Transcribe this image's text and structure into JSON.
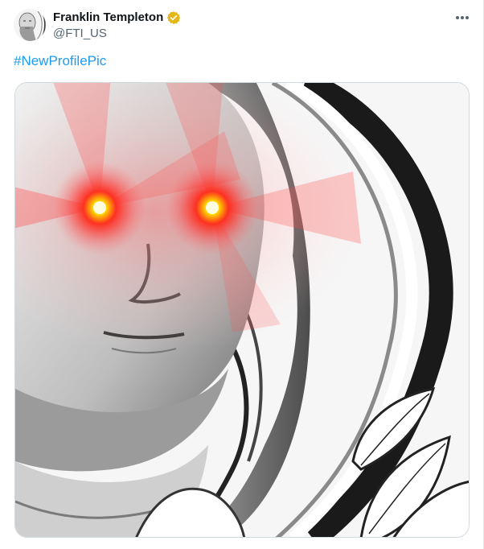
{
  "author": {
    "display_name": "Franklin Templeton",
    "handle": "@FTI_US",
    "verified_badge": "gold-verified-badge-icon",
    "badge_color": "#e2b719"
  },
  "tweet": {
    "hashtag": "#NewProfilePic",
    "media_description_icon": "portrait-laser-eyes-image"
  },
  "menu": {
    "more_icon": "more-horizontal-icon"
  },
  "colors": {
    "link": "#1d9bf0",
    "secondary_text": "#536471",
    "laser": "#ff1a1a",
    "laser_core": "#ffe600"
  }
}
